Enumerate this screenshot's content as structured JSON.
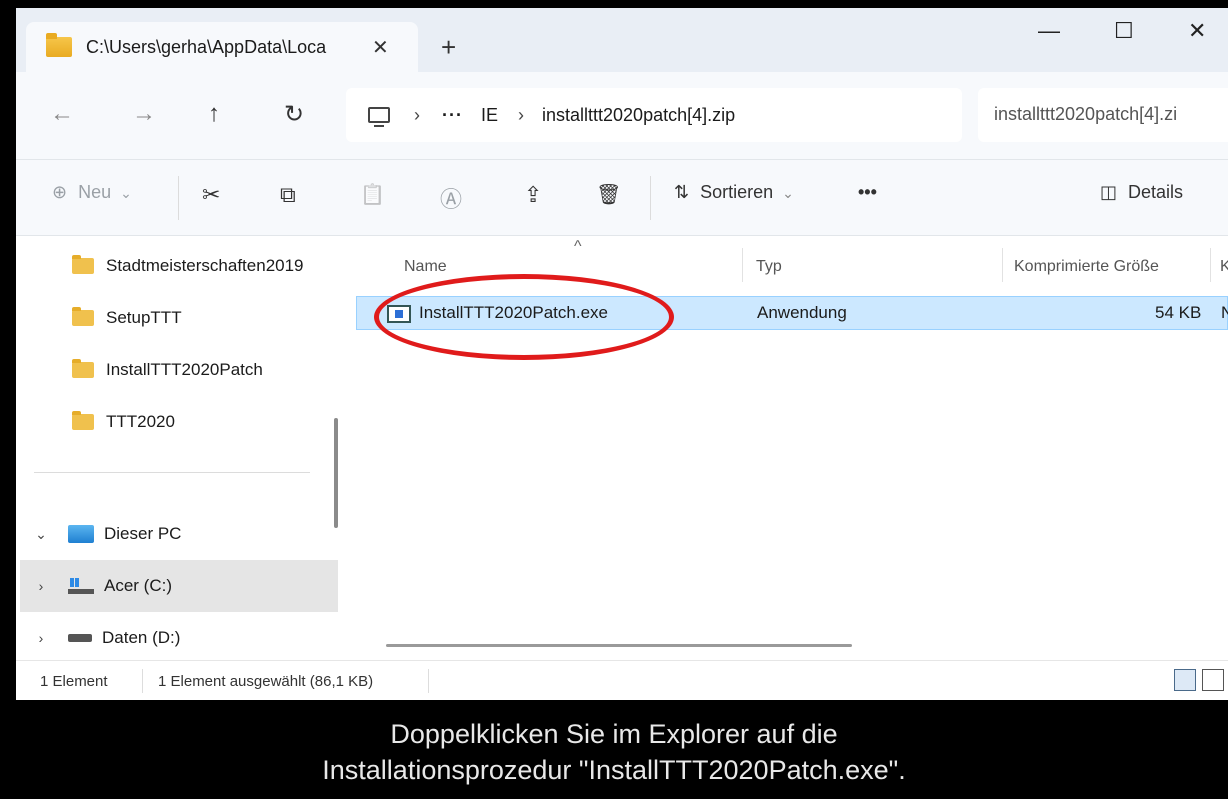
{
  "window": {
    "tab_title": "C:\\Users\\gerha\\AppData\\Loca",
    "tab_close": "✕",
    "new_tab": "+",
    "minimize": "—",
    "maximize": "☐",
    "close": "✕"
  },
  "nav": {
    "back": "←",
    "forward": "→",
    "up": "↑",
    "refresh": "↻",
    "breadcrumb_sep": "›",
    "breadcrumb_more": "···",
    "crumb_1": "IE",
    "crumb_2": "installttt2020patch[4].zip",
    "search_text": "installttt2020patch[4].zi"
  },
  "commands": {
    "new_label": "Neu",
    "new_icon": "⊕",
    "new_caret": "⌄",
    "cut_icon": "✂",
    "copy_icon": "⧉",
    "paste_icon": "📋",
    "rename_icon": "Ⓐ",
    "share_icon": "⇪",
    "delete_icon": "🗑",
    "sort_icon": "⇅",
    "sort_label": "Sortieren",
    "sort_caret": "⌄",
    "more": "•••",
    "details_icon": "◫",
    "details_label": "Details"
  },
  "sidebar": {
    "items": [
      {
        "label": "Stadtmeisterschaften2019"
      },
      {
        "label": "SetupTTT"
      },
      {
        "label": "InstallTTT2020Patch"
      },
      {
        "label": "TTT2020"
      }
    ],
    "this_pc": {
      "chevron": "⌄",
      "label": "Dieser PC"
    },
    "drives": [
      {
        "chevron": "›",
        "label": "Acer (C:)"
      },
      {
        "chevron": "›",
        "label": "Daten (D:)"
      }
    ]
  },
  "file_list": {
    "sort_caret": "^",
    "columns": {
      "name": "Name",
      "type": "Typ",
      "compressed_size": "Komprimierte Größe",
      "next_col_partial": "K"
    },
    "rows": [
      {
        "name": "InstallTTT2020Patch.exe",
        "type": "Anwendung",
        "size": "54 KB",
        "extra": "N"
      }
    ]
  },
  "status": {
    "count": "1 Element",
    "selection": "1 Element ausgewählt (86,1 KB)"
  },
  "caption": {
    "line1": "Doppelklicken Sie im Explorer auf die",
    "line2": "Installationsprozedur \"InstallTTT2020Patch.exe\"."
  },
  "colors": {
    "selection": "#cce8ff",
    "highlight_circle": "#e01b1b",
    "folder": "#f0c14d"
  }
}
